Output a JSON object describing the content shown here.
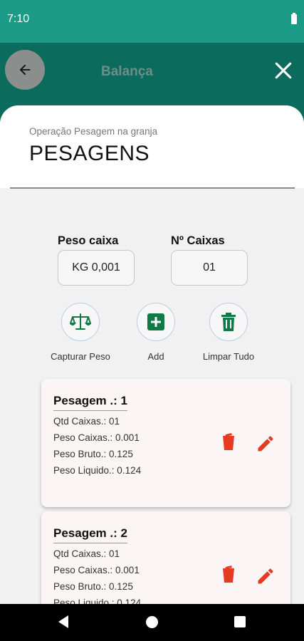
{
  "status_bar": {
    "time": "7:10"
  },
  "app_bar": {
    "title": "Balança",
    "behind_text": "o... "
  },
  "sheet": {
    "subtitle": "Operação Pesagem na granja",
    "title": "PESAGENS"
  },
  "fields": {
    "peso_caixa": {
      "label": "Peso caixa",
      "value": "KG 0,001"
    },
    "num_caixas": {
      "label": "Nº Caixas",
      "value": "01"
    }
  },
  "actions": {
    "capturar": "Capturar Peso",
    "add": "Add",
    "limpar": "Limpar Tudo"
  },
  "colors": {
    "accent": "#1a9a87",
    "action_green": "#0f7a45",
    "danger": "#e63a22"
  },
  "pesagens": [
    {
      "title": "Pesagem .: 1",
      "qtd": "Qtd Caixas.: 01",
      "peso_caixas": "Peso Caixas.: 0.001",
      "bruto": "Peso Bruto.: 0.125",
      "liquido": "Peso Liquido.: 0.124"
    },
    {
      "title": "Pesagem .: 2",
      "qtd": "Qtd Caixas.: 01",
      "peso_caixas": "Peso Caixas.: 0.001",
      "bruto": "Peso Bruto.: 0.125",
      "liquido": "Peso Liquido.: 0.124"
    }
  ]
}
